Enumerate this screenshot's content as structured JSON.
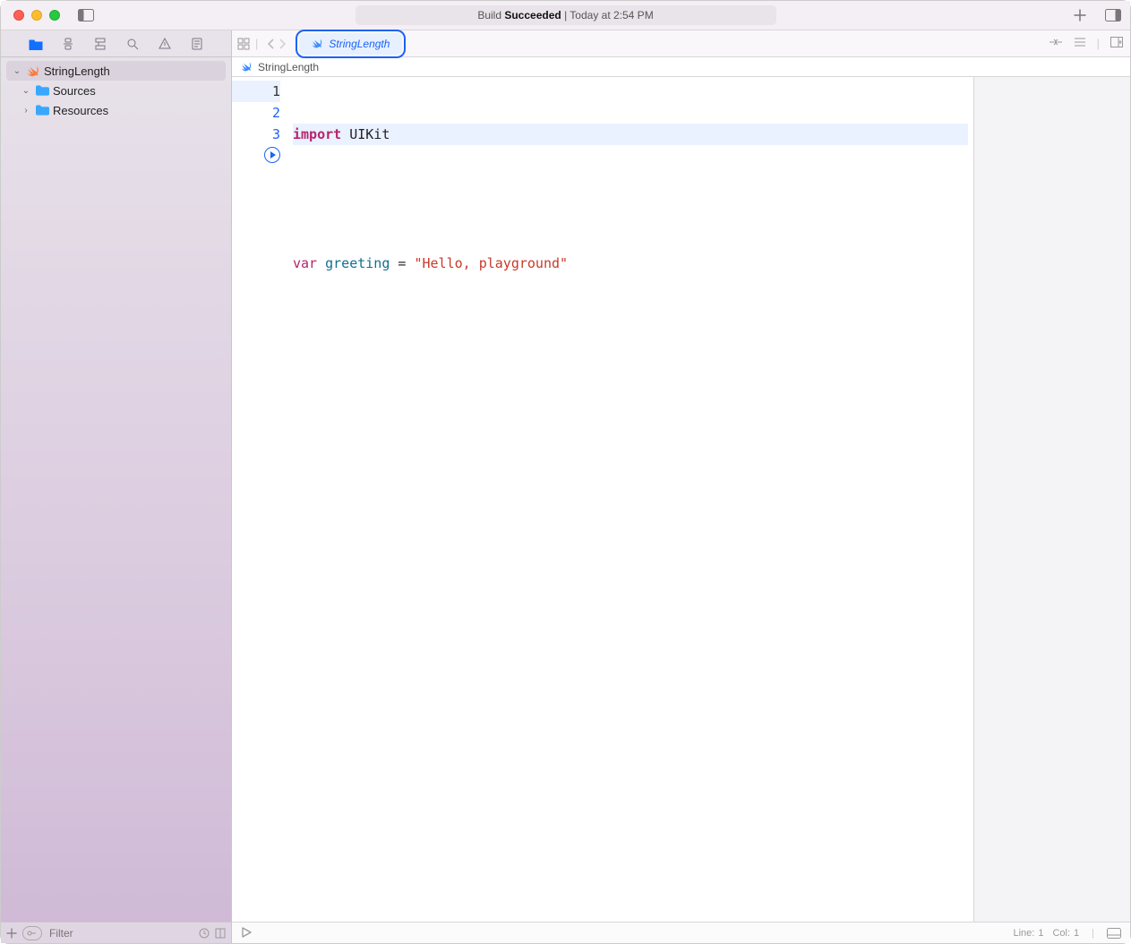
{
  "titlebar": {
    "build_label": "Build",
    "build_status": "Succeeded",
    "build_time_separator": " | ",
    "build_time": "Today at 2:54 PM"
  },
  "sidebar": {
    "items": [
      {
        "label": "StringLength"
      },
      {
        "label": "Sources"
      },
      {
        "label": "Resources"
      }
    ],
    "filter_placeholder": "Filter"
  },
  "tabbar": {
    "tab_label": "StringLength"
  },
  "breadcrumb": {
    "path": "StringLength"
  },
  "editor": {
    "lines": {
      "l1": {
        "n": "1",
        "kw": "import",
        "sp": " ",
        "id": "UIKit"
      },
      "l2": {
        "n": "2",
        "text": ""
      },
      "l3": {
        "n": "3",
        "kw": "var",
        "sp1": " ",
        "name": "greeting",
        "sp2": " ",
        "eq": "=",
        "sp3": " ",
        "str": "\"Hello, playground\""
      }
    }
  },
  "status": {
    "line_label": "Line:",
    "line": "1",
    "col_label": "Col:",
    "col": "1"
  }
}
